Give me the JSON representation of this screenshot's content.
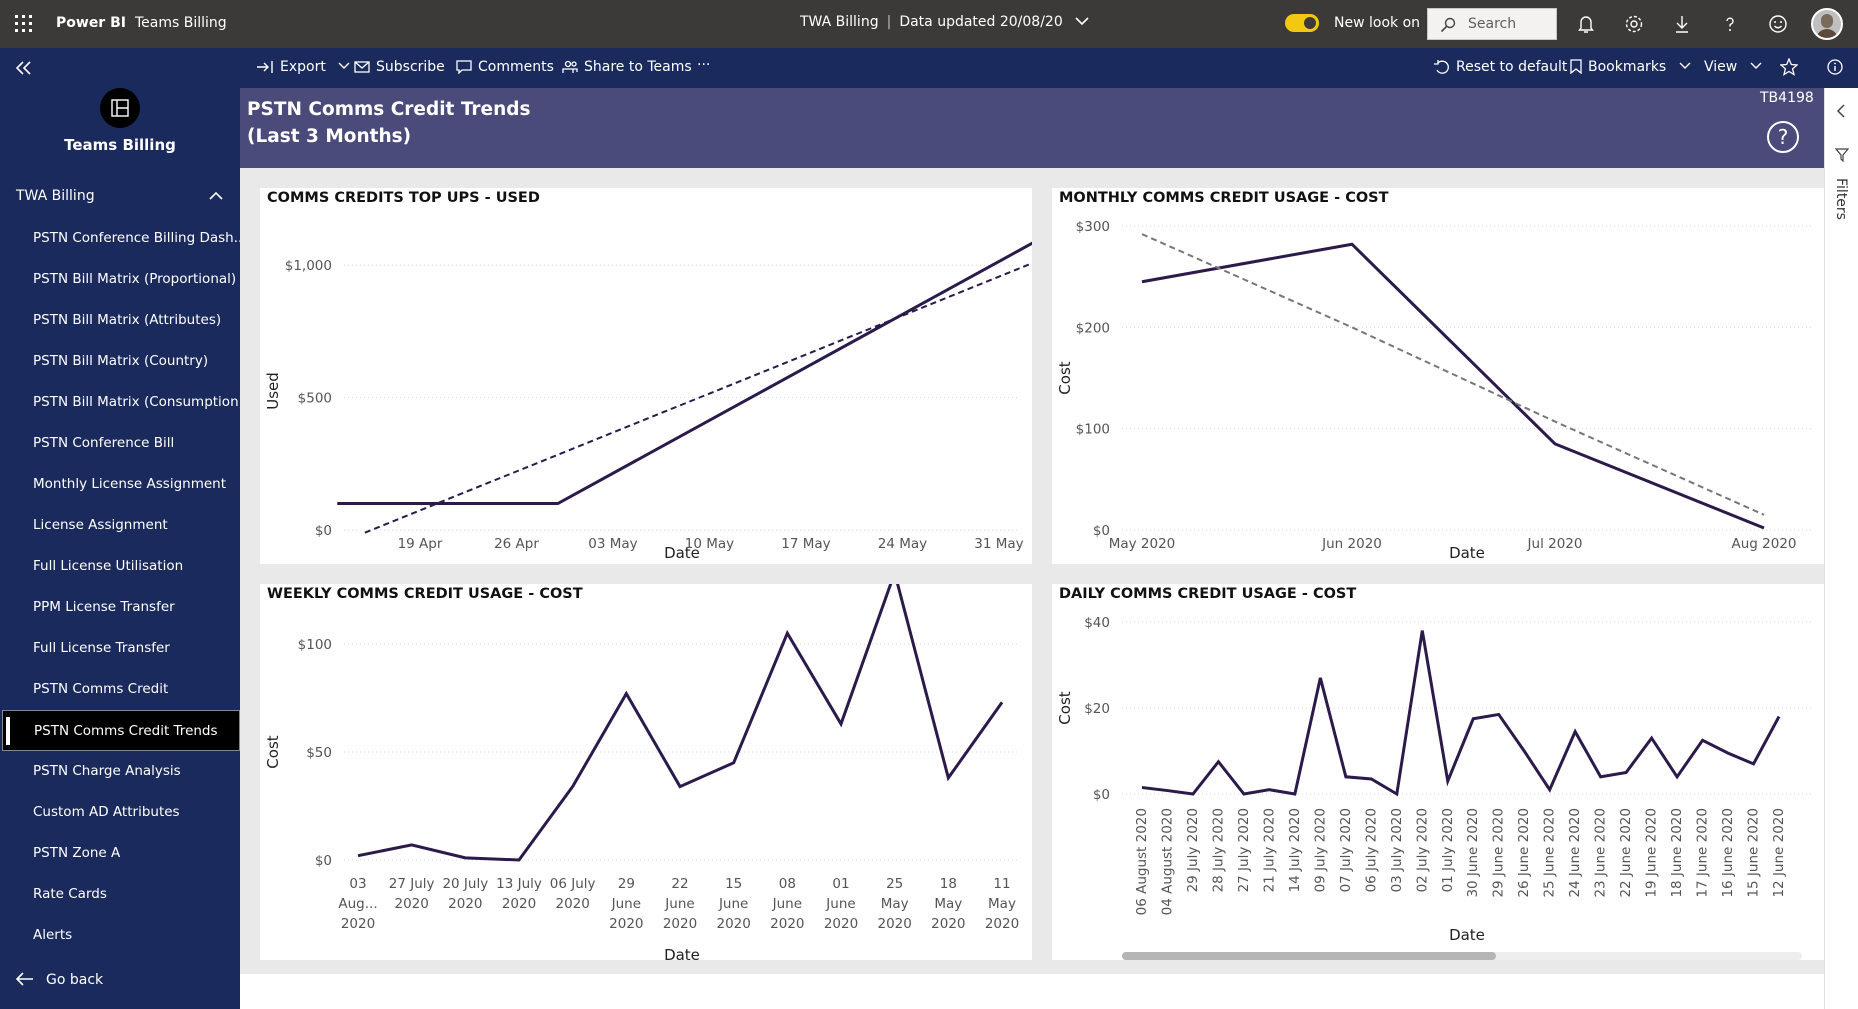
{
  "topbar": {
    "brand": "Power BI",
    "workspace": "Teams Billing",
    "report_name": "TWA Billing",
    "data_updated": "Data updated 20/08/20",
    "new_look_label": "New look on",
    "new_look_on": true,
    "search_placeholder": "Search"
  },
  "sidebar": {
    "title": "Teams Billing",
    "group": "TWA Billing",
    "items": [
      {
        "label": "PSTN Conference Billing Dash..."
      },
      {
        "label": "PSTN Bill Matrix (Proportional)"
      },
      {
        "label": "PSTN Bill Matrix (Attributes)"
      },
      {
        "label": "PSTN Bill Matrix (Country)"
      },
      {
        "label": "PSTN Bill Matrix (Consumption)"
      },
      {
        "label": "PSTN Conference Bill"
      },
      {
        "label": "Monthly License Assignment"
      },
      {
        "label": "License Assignment"
      },
      {
        "label": "Full License Utilisation"
      },
      {
        "label": "PPM License Transfer"
      },
      {
        "label": "Full License Transfer"
      },
      {
        "label": "PSTN Comms Credit"
      },
      {
        "label": "PSTN Comms Credit Trends",
        "active": true
      },
      {
        "label": "PSTN Charge Analysis"
      },
      {
        "label": "Custom AD Attributes"
      },
      {
        "label": "PSTN Zone A"
      },
      {
        "label": "Rate Cards"
      },
      {
        "label": "Alerts"
      }
    ],
    "go_back": "Go back"
  },
  "actionbar": {
    "export": "Export",
    "subscribe": "Subscribe",
    "comments": "Comments",
    "share": "Share to Teams",
    "more": "···",
    "reset": "Reset to default",
    "bookmarks": "Bookmarks",
    "view": "View"
  },
  "page": {
    "title_line1": "PSTN Comms Credit Trends",
    "title_line2": "(Last 3 Months)",
    "code": "TB4198",
    "help": "?"
  },
  "filters_label": "Filters",
  "colors": {
    "line": "#2b1a4a",
    "trend": "#2b1a4a",
    "banner": "#4a4a7b",
    "nav": "#1b2a5c"
  },
  "chart_data": [
    {
      "id": "topups",
      "type": "line",
      "title": "COMMS CREDITS TOP UPS - USED",
      "xlabel": "Date",
      "ylabel": "Used",
      "x_ticks": [
        "19 Apr",
        "26 Apr",
        "03 May",
        "10 May",
        "17 May",
        "24 May",
        "31 May"
      ],
      "y_ticks": [
        "$0",
        "$500",
        "$1,000"
      ],
      "ylim": [
        0,
        1050
      ],
      "x_range_days": [
        0,
        49
      ],
      "series": [
        {
          "points": [
            [
              -4,
              100
            ],
            [
              12,
              100
            ],
            [
              47,
              1100
            ]
          ]
        }
      ],
      "trend": [
        [
          -2,
          -10
        ],
        [
          47,
          1020
        ]
      ]
    },
    {
      "id": "monthly",
      "type": "line",
      "title": "MONTHLY COMMS CREDIT USAGE - COST",
      "xlabel": "Date",
      "ylabel": "Cost",
      "categories": [
        "May 2020",
        "Jun 2020",
        "Jul 2020",
        "Aug 2020"
      ],
      "y_ticks": [
        "$0",
        "$100",
        "$200",
        "$300"
      ],
      "ylim": [
        0,
        300
      ],
      "series": [
        {
          "values": [
            245,
            282,
            85,
            2
          ]
        }
      ],
      "trend": [
        292,
        200,
        107,
        15
      ]
    },
    {
      "id": "weekly",
      "type": "line",
      "title": "WEEKLY COMMS CREDIT USAGE - COST",
      "xlabel": "Date",
      "ylabel": "Cost",
      "categories": [
        [
          "03",
          "Aug...",
          "2020"
        ],
        [
          "27 July",
          "2020"
        ],
        [
          "20 July",
          "2020"
        ],
        [
          "13 July",
          "2020"
        ],
        [
          "06 July",
          "2020"
        ],
        [
          "29",
          "June",
          "2020"
        ],
        [
          "22",
          "June",
          "2020"
        ],
        [
          "15",
          "June",
          "2020"
        ],
        [
          "08",
          "June",
          "2020"
        ],
        [
          "01",
          "June",
          "2020"
        ],
        [
          "25",
          "May",
          "2020"
        ],
        [
          "18",
          "May",
          "2020"
        ],
        [
          "11",
          "May",
          "2020"
        ]
      ],
      "y_ticks": [
        "$0",
        "$50",
        "$100"
      ],
      "ylim": [
        0,
        100
      ],
      "series": [
        {
          "values": [
            2,
            7,
            1,
            0,
            34,
            77,
            34,
            45,
            105,
            63,
            133,
            38,
            73
          ]
        }
      ]
    },
    {
      "id": "daily",
      "type": "line",
      "title": "DAILY COMMS CREDIT USAGE - COST",
      "xlabel": "Date",
      "ylabel": "Cost",
      "categories": [
        "06 August 2020",
        "04 August 2020",
        "29 July 2020",
        "28 July 2020",
        "27 July 2020",
        "21 July 2020",
        "14 July 2020",
        "09 July 2020",
        "07 July 2020",
        "06 July 2020",
        "03 July 2020",
        "02 July 2020",
        "01 July 2020",
        "30 June 2020",
        "29 June 2020",
        "26 June 2020",
        "25 June 2020",
        "24 June 2020",
        "23 June 2020",
        "22 June 2020",
        "19 June 2020",
        "18 June 2020",
        "17 June 2020",
        "16 June 2020",
        "15 June 2020",
        "12 June 2020"
      ],
      "y_ticks": [
        "$0",
        "$20",
        "$40"
      ],
      "ylim": [
        0,
        40
      ],
      "series": [
        {
          "values": [
            1.5,
            0.8,
            0,
            7.5,
            0,
            1,
            0,
            27,
            4,
            3.5,
            0,
            38,
            3,
            17.5,
            18.5,
            10,
            1,
            14.5,
            4,
            5,
            13,
            4,
            12.5,
            9.5,
            7,
            18
          ]
        }
      ]
    }
  ]
}
